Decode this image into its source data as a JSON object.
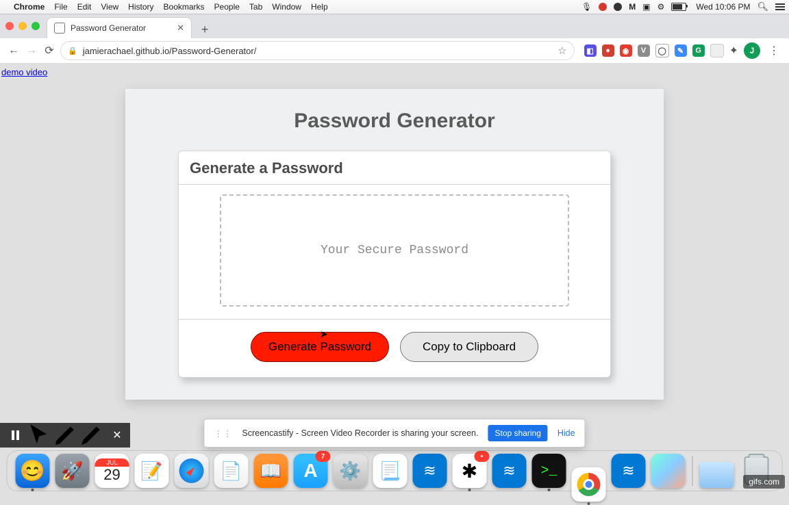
{
  "menubar": {
    "items": [
      "Chrome",
      "File",
      "Edit",
      "View",
      "History",
      "Bookmarks",
      "People",
      "Tab",
      "Window",
      "Help"
    ],
    "clock": "Wed 10:06 PM"
  },
  "browser": {
    "tab_title": "Password Generator",
    "url": "jamierachael.github.io/Password-Generator/",
    "avatar_initial": "J"
  },
  "page": {
    "demo_link": "demo video",
    "title": "Password Generator",
    "panel_header": "Generate a Password",
    "password_placeholder": "Your Secure Password",
    "buttons": {
      "generate": "Generate Password",
      "copy": "Copy to Clipboard"
    }
  },
  "share": {
    "text": "Screencastify - Screen Video Recorder is sharing your screen.",
    "stop": "Stop sharing",
    "hide": "Hide"
  },
  "dock": {
    "cal_month": "JUL",
    "cal_day": "29",
    "appstore_badge": "7",
    "slack_badge": ""
  },
  "watermark": "gifs.com"
}
